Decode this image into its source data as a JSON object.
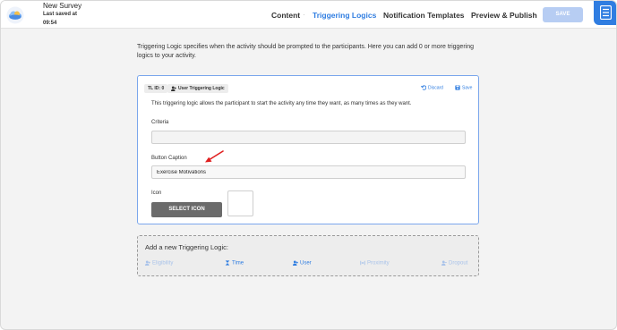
{
  "header": {
    "survey_title": "New Survey",
    "saved_label": "Last saved at",
    "saved_time": "09:54",
    "nav": {
      "content": "Content",
      "triggering_logics": "Triggering Logics",
      "notification_templates": "Notification Templates",
      "preview_publish": "Preview & Publish",
      "separator": "·"
    },
    "save_label": "SAVE"
  },
  "main": {
    "intro": "Triggering Logic specifies when the activity should be prompted to the participants. Here you can add 0 or more triggering logics to your activity.",
    "card": {
      "tl_id": "TL ID: 0",
      "tl_type": "User Triggering Logic",
      "discard_label": "Discard",
      "save_label": "Save",
      "description": "This triggering logic allows the participant to start the activity any time they want, as many times as they want.",
      "criteria_label": "Criteria",
      "criteria_value": "",
      "button_caption_label": "Button Caption",
      "button_caption_value": "Exercise Motivations",
      "icon_label": "Icon",
      "select_icon_label": "SELECT ICON"
    },
    "add": {
      "title": "Add a new Triggering Logic:",
      "options": [
        {
          "label": "Eligibility",
          "enabled": false
        },
        {
          "label": "Time",
          "enabled": true
        },
        {
          "label": "User",
          "enabled": true
        },
        {
          "label": "Proximity",
          "enabled": false
        },
        {
          "label": "Dropout",
          "enabled": false
        }
      ]
    }
  },
  "colors": {
    "accent": "#2f7de1",
    "save_disabled": "#b7cdf3",
    "select_icon_bg": "#6b6b6b",
    "annotation_arrow": "#e02020"
  }
}
